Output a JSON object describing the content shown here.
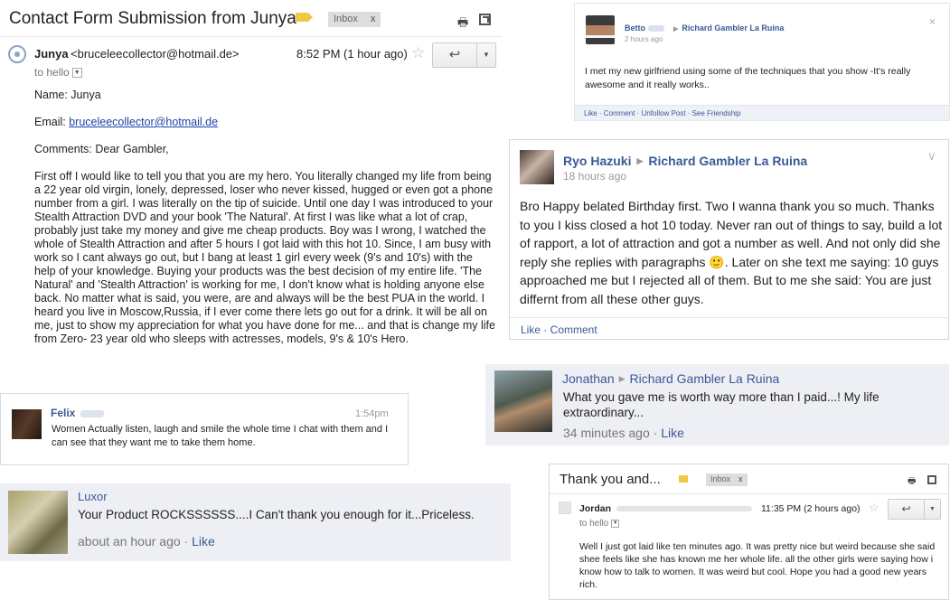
{
  "gmail_main": {
    "subject": "Contact Form Submission from Junya",
    "label_chip": "Inbox",
    "label_chip_close": "x",
    "sender_name": "Junya",
    "sender_email": "<brucelee​collector@hotmail.de>",
    "time": "8:52 PM (1 hour ago)",
    "to": "to hello",
    "body_name": "Name: Junya",
    "email_prefix": "Email: ",
    "email_link": "bruceleecollector@hotmail.de",
    "comments": "Comments: Dear Gambler,",
    "body_paragraph": "First off I would like to tell you that you are my hero. You literally changed my life from being a 22 year old virgin, lonely, depressed, loser who never kissed, hugged or even got a phone number from a girl. I was literally on the tip of suicide. Until one day I was introduced to your Stealth Attraction DVD and your book 'The Natural'. At first I was like what a lot of crap, probably just take my money and give me cheap products. Boy was I wrong, I watched the whole of Stealth Attraction and after 5 hours I got laid with this hot 10. Since, I am busy with work so I cant always go out, but I bang at least 1 girl every week (9's and 10's) with the help of your knowledge. Buying your products was the best decision of my entire life. 'The Natural' and 'Stealth Attraction' is working for me, I don't know what is holding anyone else back. No matter what is said, you were, are and always will be the best PUA in the world. I heard you live in Moscow,Russia, if I ever come there lets go out for a drink. It will be all on me, just to show my appreciation for what you have done for me... and that is change my life from Zero- 23 year old who sleeps with actresses, models, 9's & 10's Hero."
  },
  "fb_betto": {
    "name": "Betto",
    "target": "Richard Gambler La Ruina",
    "time": "2 hours ago",
    "text": "I met my new girlfriend using some of the techniques that you show -It's really awesome and it really works..",
    "actions": "Like · Comment · Unfollow Post · See Friendship"
  },
  "fb_ryo": {
    "name": "Ryo Hazuki",
    "target": "Richard Gambler La Ruina",
    "time": "18 hours ago",
    "text": "Bro Happy belated Birthday first. Two I wanna thank you so much. Thanks to you I kiss closed a hot 10 today. Never ran out of things to say, build a lot of rapport, a lot of attraction and got a number as well. And not only did she reply she replies with paragraphs 🙂. Later on she text me saying: 10 guys approached me but I rejected all of them. But to me she said: You are just differnt from all these other guys.",
    "actions": "Like · Comment"
  },
  "fb_jonathan": {
    "name": "Jonathan",
    "target": "Richard Gambler La Ruina",
    "text": "What you gave me is worth way more than I paid...! My life extraordinary...",
    "time": "34 minutes ago",
    "like": "Like"
  },
  "felix": {
    "name": "Felix",
    "time": "1:54pm",
    "text": "Women Actually listen, laugh and smile the whole time I chat with them and I can see that they want me to take them home."
  },
  "luxor": {
    "name": "Luxor",
    "text": "Your Product ROCKSSSSSS....I Can't thank you enough for it...Priceless.",
    "time": "about an hour ago",
    "like": "Like"
  },
  "gmail_small": {
    "subject": "Thank you and...",
    "label_chip": "Inbox",
    "label_chip_close": "x",
    "sender_name": "Jordan",
    "time": "11:35 PM (2 hours ago)",
    "to": "to hello",
    "body": "Well I just got laid like ten minutes ago. It was pretty nice but weird because she said shee feels like she has known me her whole life. all the other girls were saying how i know how to talk to women. It was weird but cool. Hope you had a good new years rich."
  },
  "icons": {
    "star": "☆",
    "reply": "↩",
    "caret": "▼",
    "arrow": "▶",
    "chevron": "∨",
    "close": "×",
    "print": "🖶"
  },
  "colors": {
    "facebook_blue": "#3b5998",
    "facebook_bg": "#edeff4",
    "gmail_link": "#1a44a7",
    "label_yellow": "#f2c744"
  }
}
